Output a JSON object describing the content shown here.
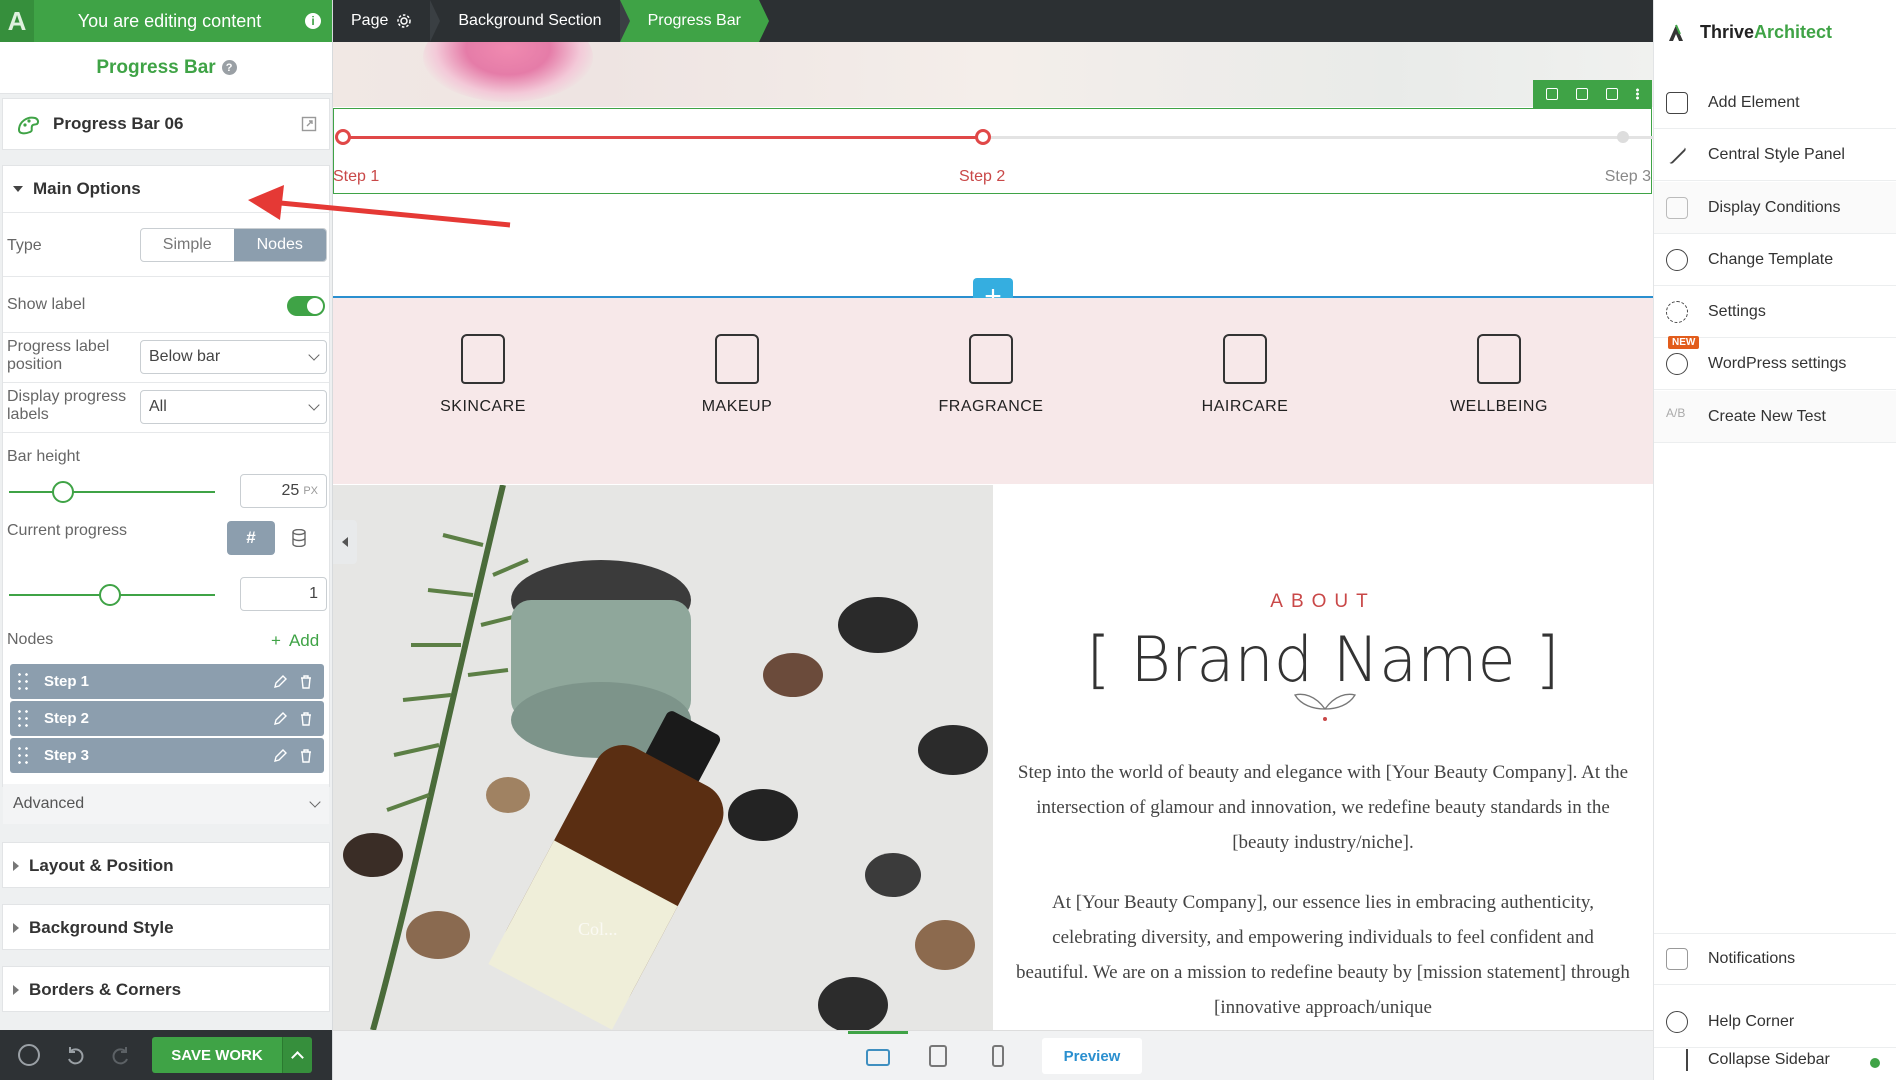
{
  "left_panel": {
    "editing_notice": "You are editing content",
    "title": "Progress Bar",
    "element_name": "Progress Bar 06",
    "main_options": {
      "header": "Main Options",
      "type_label": "Type",
      "type_options": [
        "Simple",
        "Nodes"
      ],
      "type_selected": "Nodes",
      "show_label_label": "Show label",
      "show_label_on": true,
      "label_position_label": "Progress label position",
      "label_position_value": "Below bar",
      "display_labels_label": "Display progress labels",
      "display_labels_value": "All",
      "bar_height_label": "Bar height",
      "bar_height_value": "25",
      "bar_height_unit": "PX",
      "current_progress_label": "Current progress",
      "current_progress_mode": "#",
      "current_progress_value": "1",
      "nodes_label": "Nodes",
      "add_label": "Add",
      "nodes": [
        "Step 1",
        "Step 2",
        "Step 3"
      ],
      "advanced_label": "Advanced"
    },
    "sections": [
      "Layout & Position",
      "Background Style",
      "Borders & Corners"
    ],
    "save_label": "SAVE WORK"
  },
  "breadcrumb": [
    "Page",
    "Background Section",
    "Progress Bar"
  ],
  "canvas": {
    "progress_steps": [
      "Step 1",
      "Step 2",
      "Step 3"
    ],
    "progress_fraction": 0.5,
    "categories": [
      "SKINCARE",
      "MAKEUP",
      "FRAGRANCE",
      "HAIRCARE",
      "WELLBEING"
    ],
    "about_kicker": "ABOUT",
    "about_heading": "[ Brand Name ]",
    "para1": "Step into the world of beauty and elegance with [Your Beauty Company]. At the intersection of glamour and innovation, we redefine beauty standards in the [beauty industry/niche].",
    "para2": "At [Your Beauty Company], our essence lies in embracing authenticity, celebrating diversity, and empowering individuals to feel confident and beautiful. We are on a mission to redefine beauty by [mission statement] through [innovative approach/unique",
    "photo_overlay": "Col..."
  },
  "bottom_bar": {
    "preview_label": "Preview"
  },
  "right_sidebar": {
    "brand_a": "Thrive",
    "brand_b": "Architect",
    "items": [
      {
        "label": "Add Element",
        "icon": "plus-square-icon"
      },
      {
        "label": "Central Style Panel",
        "icon": "brush-icon"
      },
      {
        "label": "Display Conditions",
        "icon": "sliders-icon"
      },
      {
        "label": "Change Template",
        "icon": "cloud-icon"
      },
      {
        "label": "Settings",
        "icon": "gear-icon"
      },
      {
        "label": "WordPress settings",
        "icon": "wordpress-icon"
      },
      {
        "label": "Create New Test",
        "icon": "ab-test-icon"
      }
    ],
    "new_badge": "NEW",
    "footer_items": [
      {
        "label": "Notifications",
        "icon": "notification-icon"
      },
      {
        "label": "Help Corner",
        "icon": "help-icon"
      },
      {
        "label": "Collapse Sidebar",
        "icon": "collapse-icon"
      }
    ]
  },
  "colors": {
    "accent": "#3fa346",
    "progress": "#e04848",
    "node_bg": "#8c9eae",
    "category_band": "#f7e8e9",
    "add_blue": "#35aee0"
  }
}
